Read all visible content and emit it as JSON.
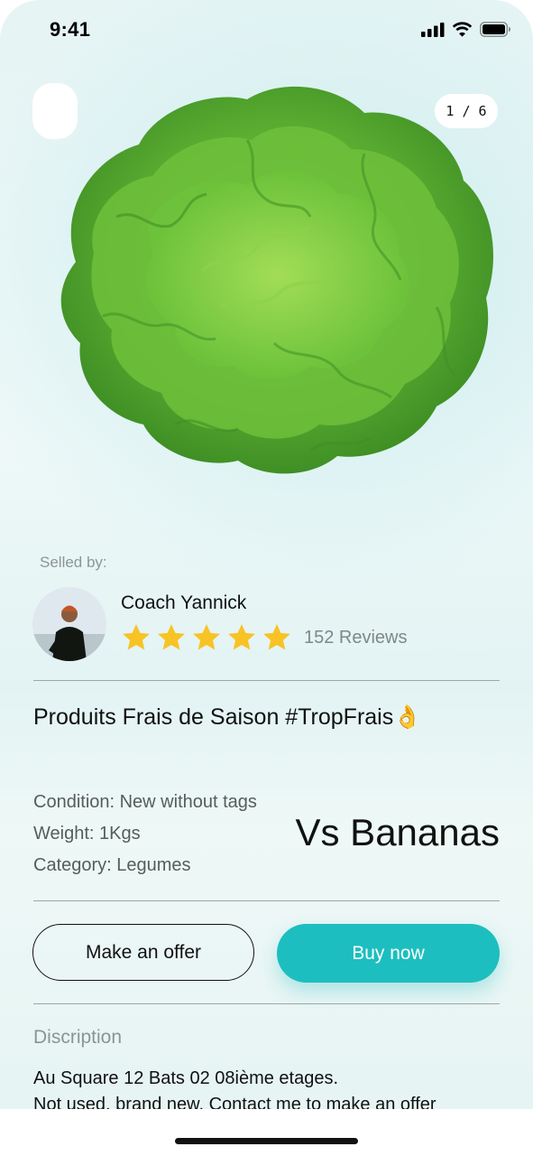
{
  "status_bar": {
    "time": "9:41",
    "icons": [
      "signal-icon",
      "wifi-icon",
      "battery-icon"
    ]
  },
  "gallery": {
    "counter": "1 / 6",
    "image": "lettuce-image"
  },
  "seller": {
    "label": "Selled by:",
    "name": "Coach Yannick",
    "rating": 5,
    "reviews": "152 Reviews"
  },
  "product": {
    "title": "Produits Frais de Saison #TropFrais👌",
    "condition": "Condition: New without tags",
    "weight": "Weight: 1Kgs",
    "category": "Category: Legumes",
    "price_label": "Vs Bananas"
  },
  "actions": {
    "offer_label": "Make an offer",
    "buy_label": "Buy now"
  },
  "description": {
    "label": "Discription",
    "line1": "Au Square 12 Bats 02 08ième etages.",
    "line2": "Not used, brand new. Contact me to make an offer"
  },
  "colors": {
    "accent": "#1dbebf",
    "star": "#f7c325",
    "background": "#e6f4f4"
  }
}
